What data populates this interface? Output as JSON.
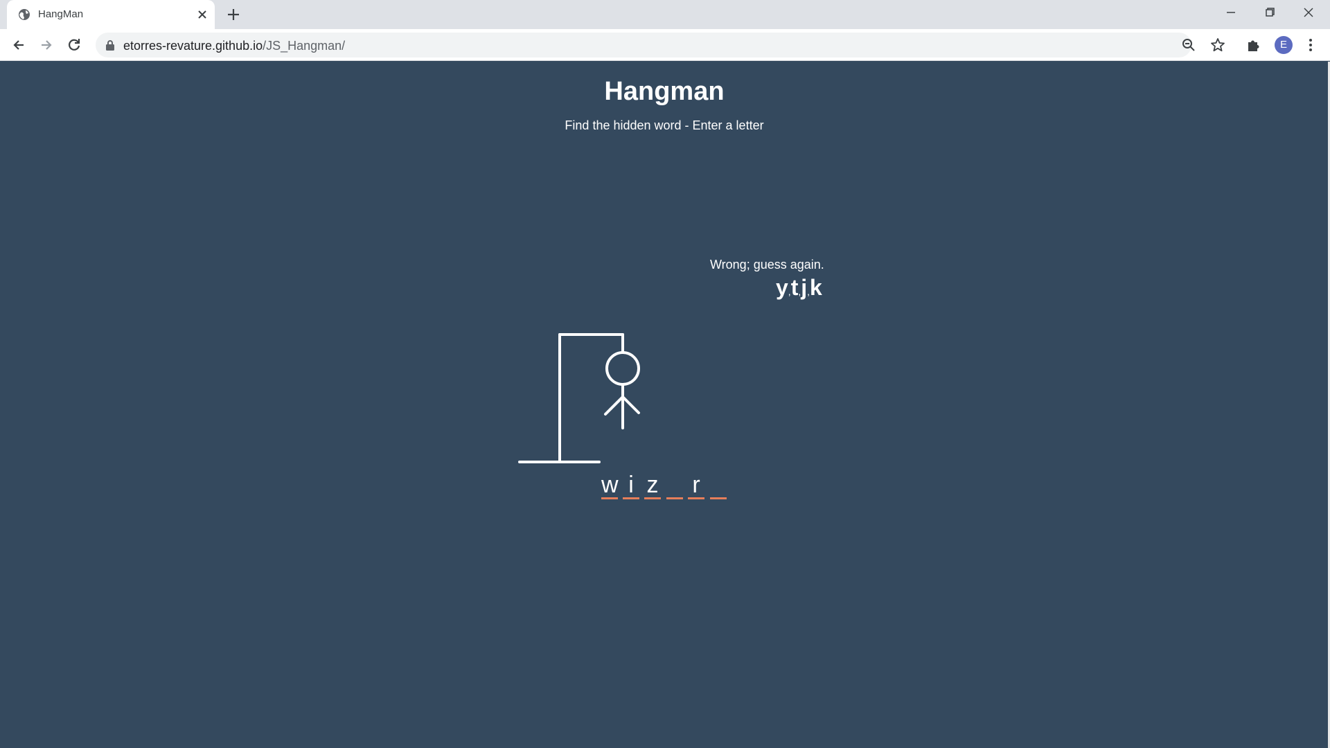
{
  "browser": {
    "tab_title": "HangMan",
    "url_domain": "etorres-revature.github.io",
    "url_path": "/JS_Hangman/",
    "profile_initial": "E"
  },
  "game": {
    "title": "Hangman",
    "subtitle": "Find the hidden word - Enter a letter",
    "wrong_message": "Wrong; guess again.",
    "wrong_letters": [
      "y",
      "t",
      "j",
      "k"
    ],
    "word_slots": [
      "w",
      "i",
      "z",
      "",
      "r",
      ""
    ],
    "colors": {
      "background": "#34495e",
      "underline": "#e67e5a",
      "text": "#ffffff"
    }
  }
}
